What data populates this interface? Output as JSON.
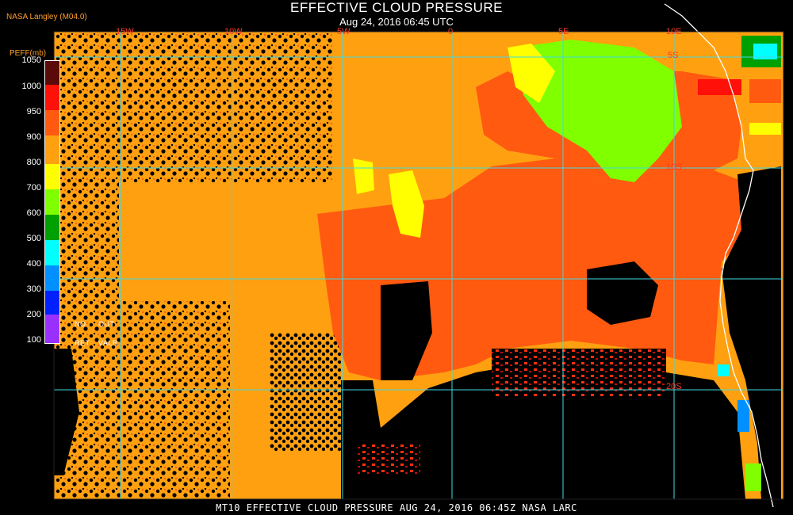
{
  "header": {
    "title": "EFFECTIVE CLOUD PRESSURE",
    "subtitle": "Aug 24, 2016 06:45 UTC",
    "org": "NASA Langley (M04.0)"
  },
  "legend": {
    "title": "PEFF(mb)",
    "ticks": [
      "1050",
      "1000",
      "950",
      "900",
      "850",
      "800",
      "700",
      "600",
      "500",
      "400",
      "300",
      "200",
      "100"
    ],
    "colors": [
      "#5a0a08",
      "#9a0a08",
      "#ff1008",
      "#ff5a10",
      "#ffa010",
      "#ffa810",
      "#ffff00",
      "#80ff00",
      "#00a000",
      "#00ffff",
      "#0090ff",
      "#0020ff",
      "#9a30ff"
    ],
    "no_ret": [
      "NO",
      "RET"
    ],
    "out_valr": [
      "OUT",
      "VALR"
    ]
  },
  "map": {
    "lon_labels": [
      "15W",
      "10W",
      "5W",
      "0",
      "5E",
      "10E"
    ],
    "lat_labels": [
      "5S",
      "10S",
      "20S"
    ],
    "grid_color": "#40d8e0",
    "coast_color": "#ffffff"
  },
  "footer": "MT10  EFFECTIVE CLOUD PRESSURE   AUG 24, 2016 06:45Z   NASA LARC"
}
